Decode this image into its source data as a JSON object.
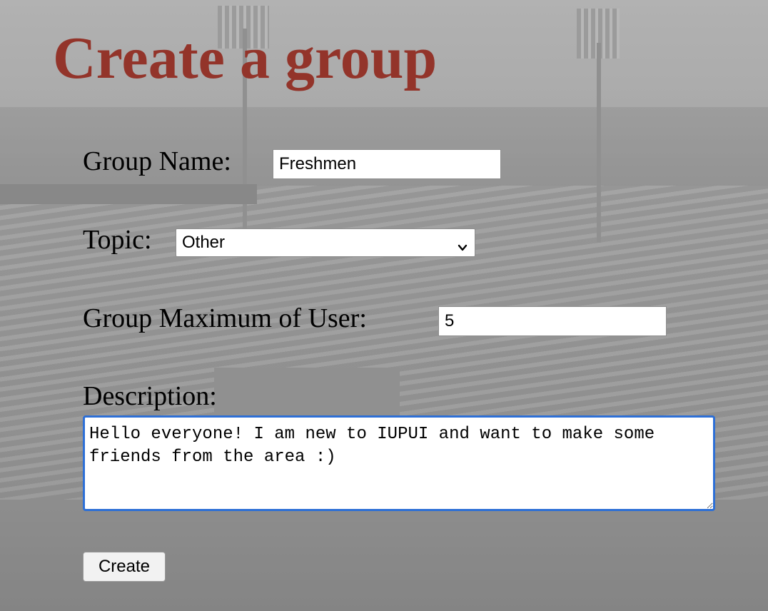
{
  "page": {
    "title": "Create a group"
  },
  "form": {
    "group_name": {
      "label": "Group Name:",
      "value": "Freshmen"
    },
    "topic": {
      "label": "Topic:",
      "selected": "Other"
    },
    "max_users": {
      "label": "Group Maximum of User:",
      "value": "5"
    },
    "description": {
      "label": "Description:",
      "value": "Hello everyone! I am new to IUPUI and want to make some friends from the area :)\n"
    },
    "submit_label": "Create"
  },
  "colors": {
    "title": "#93342a",
    "focus_border": "#2d6fd6"
  }
}
